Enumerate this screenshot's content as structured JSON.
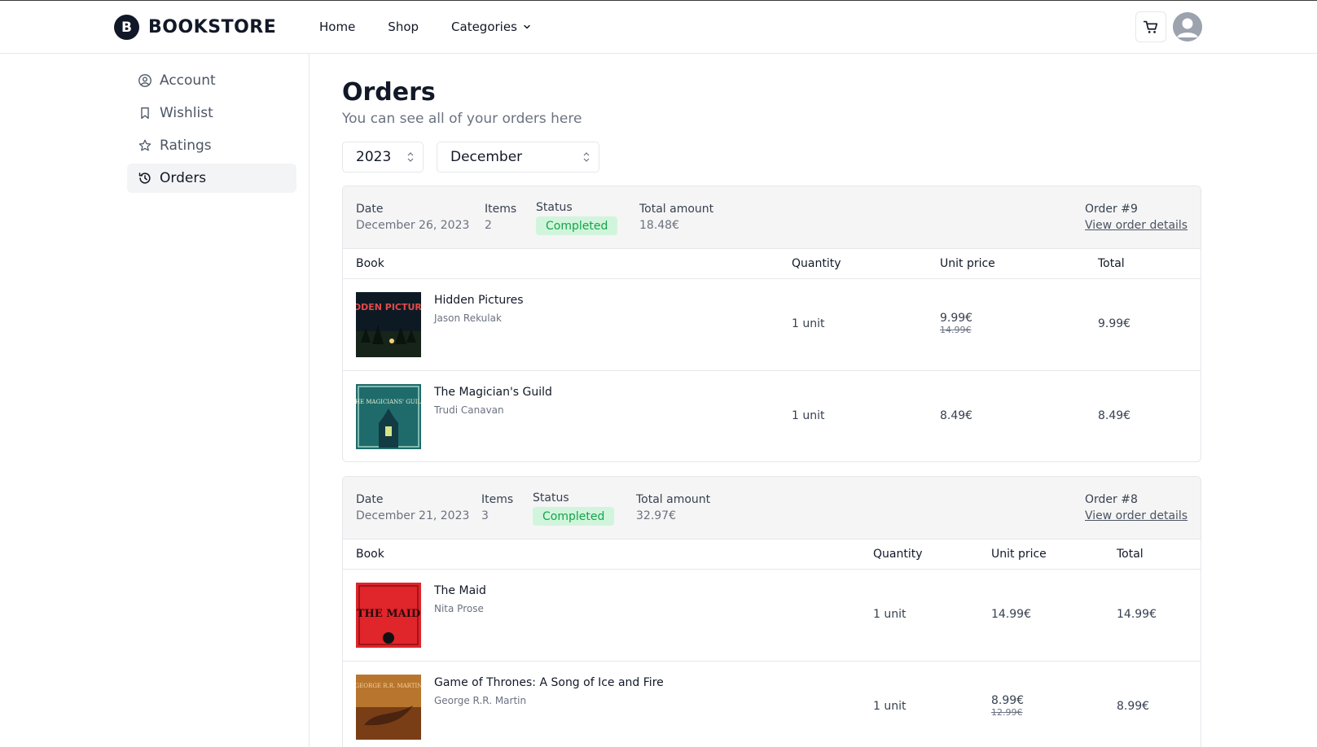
{
  "header": {
    "logo_letter": "B",
    "brand": "BOOKSTORE",
    "nav": [
      "Home",
      "Shop",
      "Categories"
    ]
  },
  "sidebar": {
    "items": [
      {
        "label": "Account",
        "icon": "user-circle-icon"
      },
      {
        "label": "Wishlist",
        "icon": "bookmark-icon"
      },
      {
        "label": "Ratings",
        "icon": "star-icon"
      },
      {
        "label": "Orders",
        "icon": "history-icon",
        "active": true
      }
    ]
  },
  "main": {
    "title": "Orders",
    "subtitle": "You can see all of your orders here",
    "year": "2023",
    "month": "December"
  },
  "labels": {
    "date": "Date",
    "items": "Items",
    "status": "Status",
    "total_amount": "Total amount",
    "view_details": "View order details",
    "col_book": "Book",
    "col_quantity": "Quantity",
    "col_unit_price": "Unit price",
    "col_total": "Total"
  },
  "orders": [
    {
      "order_label": "Order #9",
      "date": "December 26, 2023",
      "items": "2",
      "status": "Completed",
      "total_amount": "18.48€",
      "books": [
        {
          "title": "Hidden Pictures",
          "author": "Jason Rekulak",
          "cover_text": "HIDDEN PICTURES",
          "quantity": "1 unit",
          "unit_price": "9.99€",
          "old_price": "14.99€",
          "total": "9.99€"
        },
        {
          "title": "The Magician's Guild",
          "author": "Trudi Canavan",
          "cover_text": "THE MAGICIANS' GUILD",
          "quantity": "1 unit",
          "unit_price": "8.49€",
          "old_price": "",
          "total": "8.49€"
        }
      ]
    },
    {
      "order_label": "Order #8",
      "date": "December 21, 2023",
      "items": "3",
      "status": "Completed",
      "total_amount": "32.97€",
      "books": [
        {
          "title": "The Maid",
          "author": "Nita Prose",
          "cover_text": "THE MAID",
          "quantity": "1 unit",
          "unit_price": "14.99€",
          "old_price": "",
          "total": "14.99€"
        },
        {
          "title": "Game of Thrones: A Song of Ice and Fire",
          "author": "George R.R. Martin",
          "cover_text": "GEORGE R.R. MARTIN",
          "quantity": "1 unit",
          "unit_price": "8.99€",
          "old_price": "12.99€",
          "total": "8.99€"
        }
      ]
    }
  ],
  "colors": {
    "accent_dark": "#111827",
    "badge_bg": "#d1f5dc",
    "badge_text": "#16a34a"
  }
}
